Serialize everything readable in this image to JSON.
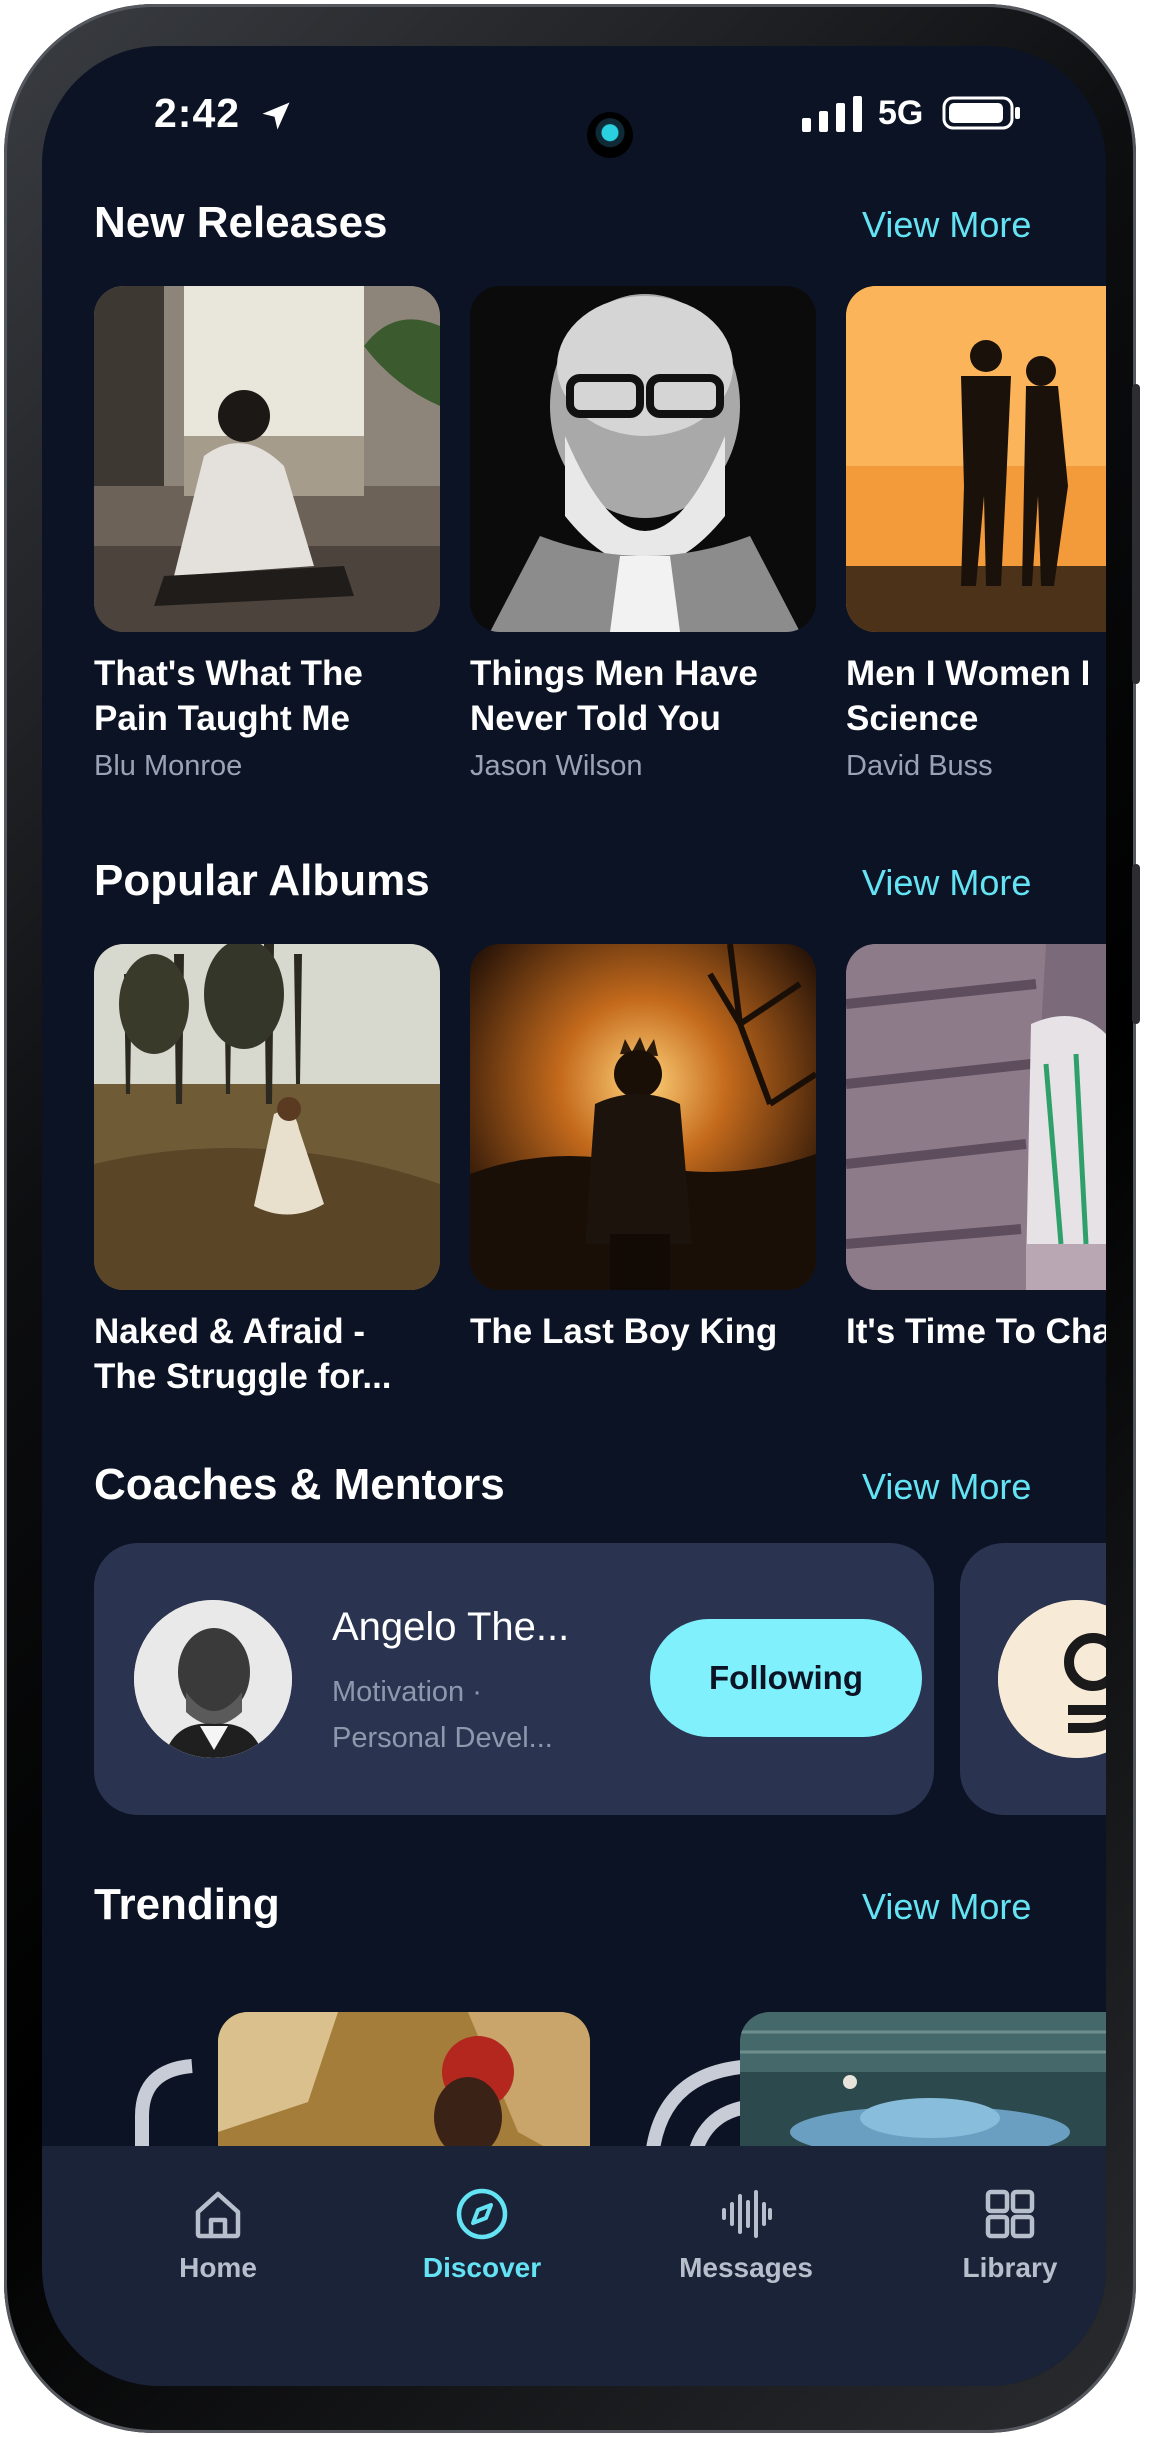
{
  "status_bar": {
    "time": "2:42",
    "network": "5G"
  },
  "new_releases": {
    "title": "New Releases",
    "view_more": "View More",
    "items": [
      {
        "title": "That's What The\nPain Taught Me",
        "author": "Blu Monroe"
      },
      {
        "title": "Things Men Have\nNever Told You",
        "author": "Jason Wilson"
      },
      {
        "title": "Men I Women I\nScience",
        "author": "David Buss"
      }
    ]
  },
  "popular_albums": {
    "title": "Popular Albums",
    "view_more": "View More",
    "items": [
      {
        "title": "Naked & Afraid -\nThe Struggle for..."
      },
      {
        "title": "The Last Boy King"
      },
      {
        "title": "It's Time To Cha"
      }
    ]
  },
  "coaches": {
    "title": "Coaches & Mentors",
    "view_more": "View More",
    "items": [
      {
        "name": "Angelo The...",
        "tags": "Motivation ·\nPersonal Devel...",
        "button": "Following"
      }
    ]
  },
  "trending": {
    "title": "Trending",
    "view_more": "View More"
  },
  "tab_bar": {
    "items": [
      {
        "label": "Home",
        "icon": "home-icon"
      },
      {
        "label": "Discover",
        "icon": "compass-icon",
        "active": true
      },
      {
        "label": "Messages",
        "icon": "waveform-icon"
      },
      {
        "label": "Library",
        "icon": "grid-icon"
      }
    ]
  },
  "colors": {
    "background": "#0c1324",
    "accent": "#63e3f4",
    "button": "#7ff0fc",
    "card": "#2a3450",
    "tabbar": "#1b2338"
  }
}
